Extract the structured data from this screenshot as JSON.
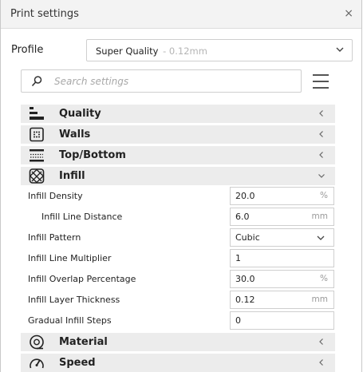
{
  "window": {
    "title": "Print settings",
    "close_glyph": "×"
  },
  "profile": {
    "label": "Profile",
    "name": "Super Quality",
    "detail": " - 0.12mm"
  },
  "search": {
    "placeholder": "Search settings",
    "value": ""
  },
  "categories": [
    {
      "label": "Quality",
      "icon": "quality-icon",
      "expanded": false
    },
    {
      "label": "Walls",
      "icon": "walls-icon",
      "expanded": false
    },
    {
      "label": "Top/Bottom",
      "icon": "top-bottom-icon",
      "expanded": false
    },
    {
      "label": "Infill",
      "icon": "infill-icon",
      "expanded": true
    },
    {
      "label": "Material",
      "icon": "material-icon",
      "expanded": false
    },
    {
      "label": "Speed",
      "icon": "speed-icon",
      "expanded": false
    }
  ],
  "infill_settings": [
    {
      "label": "Infill Density",
      "value": "20.0",
      "unit": "%"
    },
    {
      "label": "Infill Line Distance",
      "value": "6.0",
      "unit": "mm"
    },
    {
      "label": "Infill Pattern",
      "value": "Cubic",
      "unit": ""
    },
    {
      "label": "Infill Line Multiplier",
      "value": "1",
      "unit": ""
    },
    {
      "label": "Infill Overlap Percentage",
      "value": "30.0",
      "unit": "%"
    },
    {
      "label": "Infill Layer Thickness",
      "value": "0.12",
      "unit": "mm"
    },
    {
      "label": "Gradual Infill Steps",
      "value": "0",
      "unit": ""
    }
  ],
  "colors": {
    "category_bg": "#ececec",
    "border": "#cfcfcf",
    "muted": "#9a9a9a"
  }
}
